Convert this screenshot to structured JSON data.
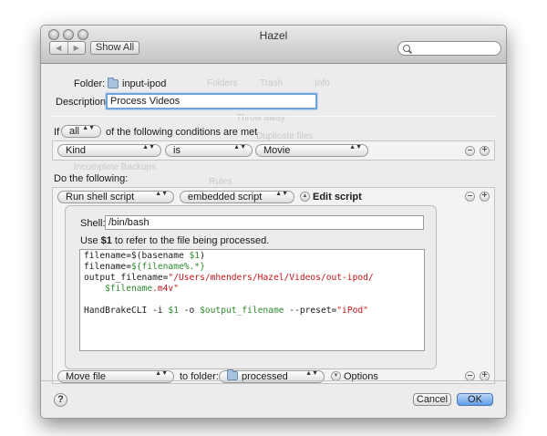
{
  "window": {
    "title": "Hazel"
  },
  "toolbar": {
    "back_glyph": "◀",
    "forward_glyph": "▶",
    "show_all_label": "Show All",
    "search_placeholder": ""
  },
  "background_tabs": [
    "Folders",
    "Trash",
    "Info"
  ],
  "background_items": [
    "Throw away",
    "Duplicate files",
    "Incomplete Backups",
    "Rules"
  ],
  "rule": {
    "folder_label": "Folder:",
    "folder_name": "input-ipod",
    "description_label": "Description:",
    "description_value": "Process Videos"
  },
  "conditions": {
    "if_label": "If",
    "match_value": "all",
    "suffix": "of the following conditions are met",
    "rows": [
      {
        "attribute": "Kind",
        "operator": "is",
        "value": "Movie"
      }
    ]
  },
  "actions": {
    "heading": "Do the following:",
    "script_action": {
      "action": "Run shell script",
      "source": "embedded script",
      "edit_label": "Edit script",
      "shell_label": "Shell:",
      "shell_value": "/bin/bash",
      "hint_prefix": "Use ",
      "hint_var": "$1",
      "hint_suffix": " to refer to the file being processed.",
      "code": {
        "l1_a": "filename=$(basename ",
        "l1_b": "$1",
        "l1_c": ")",
        "l2_a": "filename=",
        "l2_b": "${filename%.*}",
        "l3_a": "output_filename=",
        "l3_b": "\"/Users/mhenders/Hazel/Videos/out-ipod/",
        "l4_a": "    ",
        "l4_b": "$filename",
        "l4_c": ".m4v\"",
        "l6_a": "HandBrakeCLI -i ",
        "l6_b": "$1",
        "l6_c": " -o ",
        "l6_d": "$output_filename",
        "l6_e": " --preset=",
        "l6_f": "\"iPod\""
      }
    },
    "move_action": {
      "action": "Move file",
      "to_label": "to folder:",
      "folder": "processed",
      "options_label": "Options"
    }
  },
  "buttons": {
    "help": "?",
    "cancel": "Cancel",
    "ok": "OK",
    "minus": "–",
    "plus": "+",
    "disclosure": "▲",
    "disclosure_down": "▼",
    "popup_arrow": "▲▼"
  },
  "colors": {
    "focus_ring": "#6fa3dc",
    "default_button": "#5e9ce6",
    "code_green": "#2f8a2f",
    "code_red": "#c0171a"
  }
}
